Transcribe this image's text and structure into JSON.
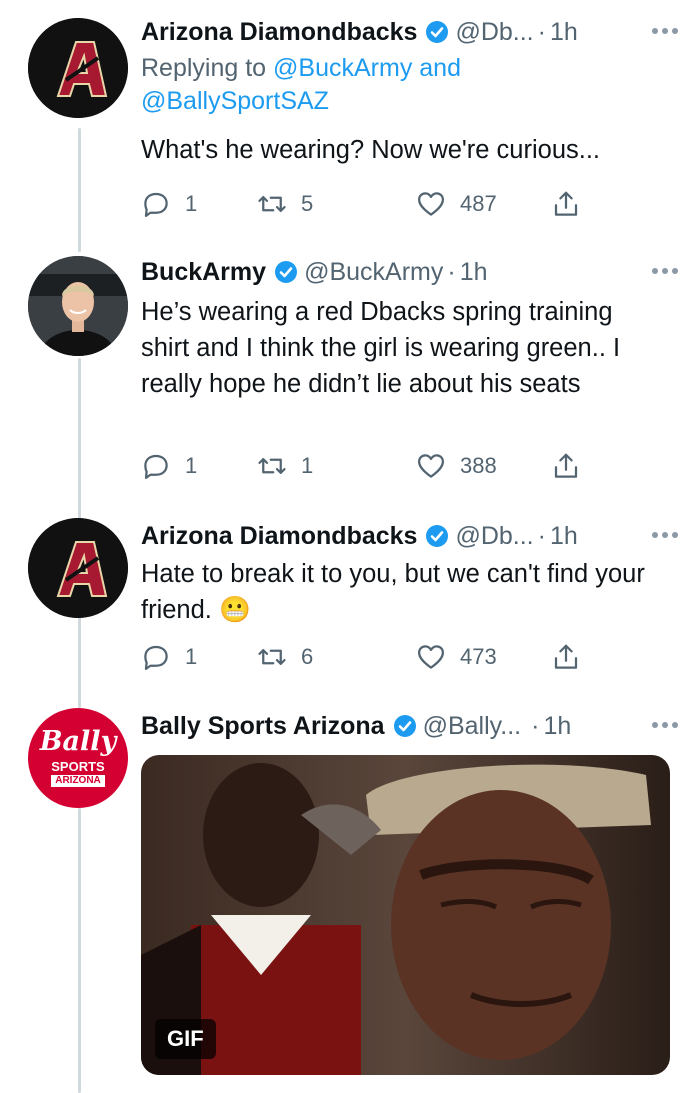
{
  "tweets": [
    {
      "name": "Arizona Diamondbacks",
      "handle": "@Db...",
      "dot": "·",
      "time": "1h",
      "reply_prefix": "Replying to",
      "reply_user1": "@BuckArmy",
      "reply_and": "and",
      "reply_user2": "@BallySportSAZ",
      "text": "What's he wearing? Now we're curious...",
      "replies": "1",
      "retweets": "5",
      "likes": "487",
      "avatar_letter": "A"
    },
    {
      "name": "BuckArmy",
      "handle": "@BuckArmy",
      "dot": "·",
      "time": "1h",
      "text": "He’s wearing a red Dbacks spring training shirt and I think the girl is wearing green.. I really hope he didn’t lie about his seats",
      "replies": "1",
      "retweets": "1",
      "likes": "388"
    },
    {
      "name": "Arizona Diamondbacks",
      "handle": "@Db...",
      "dot": "·",
      "time": "1h",
      "text": "Hate to break it to you, but we can't find your friend. 😬",
      "replies": "1",
      "retweets": "6",
      "likes": "473",
      "avatar_letter": "A"
    },
    {
      "name": "Bally Sports Arizona",
      "handle": "@Bally...",
      "dot": "·",
      "time": "1h",
      "logo_bally": "Bally",
      "logo_sports": "SPORTS",
      "logo_arizona": "ARIZONA",
      "gif_badge": "GIF"
    }
  ],
  "colors": {
    "accent": "#1d9bf0",
    "muted": "#536471",
    "dbacks_red": "#a71930",
    "bally_red": "#d50032"
  }
}
